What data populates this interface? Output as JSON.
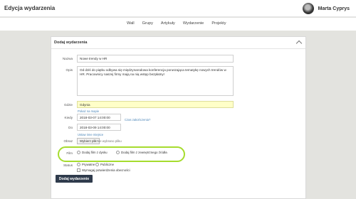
{
  "header": {
    "title": "Edycja wydarzenia",
    "user_name": "Marta Cyprys"
  },
  "nav": {
    "items": [
      "Wall",
      "Grupy",
      "Artykuły",
      "Wydarzenie",
      "Projekty"
    ]
  },
  "form": {
    "card_title": "Dodaj wydarzenia",
    "name_label": "Nazwa",
    "name_value": "Nowe trendy w HR",
    "desc_label": "Opis",
    "desc_value": "Od dziś do piątku odbywa się międzynarodowa konferencja poruszająca tematykę nowych trendów w HR. Pracownicy naszej firmy mają na nią wstęp bezpłatny!",
    "where_label": "Gdzie",
    "where_value": "Gdynia",
    "show_map": "Pokaż na mapie",
    "when_label": "Kiedy",
    "when_value": "2018-03-07 14:00:00",
    "to_label": "Do",
    "to_value": "2018-03-09 14:00:00",
    "timezone_link": "Czas zakończenia?",
    "change_place": "Ustaw inne miejsce",
    "image_label": "Obraz",
    "file_button": "Wybierz plik",
    "file_status": "Nie wybrano pliku",
    "film_label": "Film",
    "film_option_1": "Dodaj film z dysku",
    "film_option_2": "Dodaj film z zewnętrznego źródła",
    "status_label": "Status",
    "status_private": "Prywatne",
    "status_public": "Publiczne",
    "require_confirm": "Wymagaj potwierdzenia obecności",
    "submit": "Dodaj wydarzenie"
  },
  "colors": {
    "highlight": "#a6dc2e",
    "submit_bg": "#2f3b4c",
    "field_yellow": "#ffffc8"
  }
}
